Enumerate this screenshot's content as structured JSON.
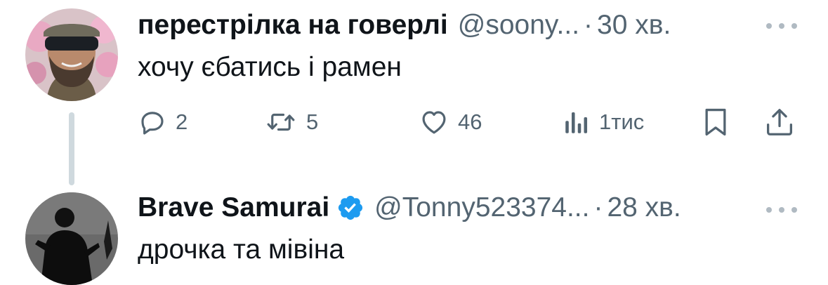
{
  "tweets": [
    {
      "display_name": "перестрілка на говерлі",
      "handle": "@soony...",
      "separator": "·",
      "time": "30 хв.",
      "text": "хочу єбатись і рамен",
      "verified": false,
      "actions": {
        "replies": "2",
        "reposts": "5",
        "likes": "46",
        "views": "1тис"
      }
    },
    {
      "display_name": "Brave Samurai",
      "handle": "@Tonny523374...",
      "separator": "·",
      "time": "28 хв.",
      "text": "дрочка та мівіна",
      "verified": true
    }
  ],
  "colors": {
    "text_primary": "#0f1419",
    "text_secondary": "#536471",
    "verified_blue": "#1d9bf0",
    "thread_line": "#cfd9de"
  },
  "icons": [
    "reply-icon",
    "repost-icon",
    "like-icon",
    "views-icon",
    "bookmark-icon",
    "share-icon",
    "more-icon",
    "verified-badge-icon"
  ]
}
